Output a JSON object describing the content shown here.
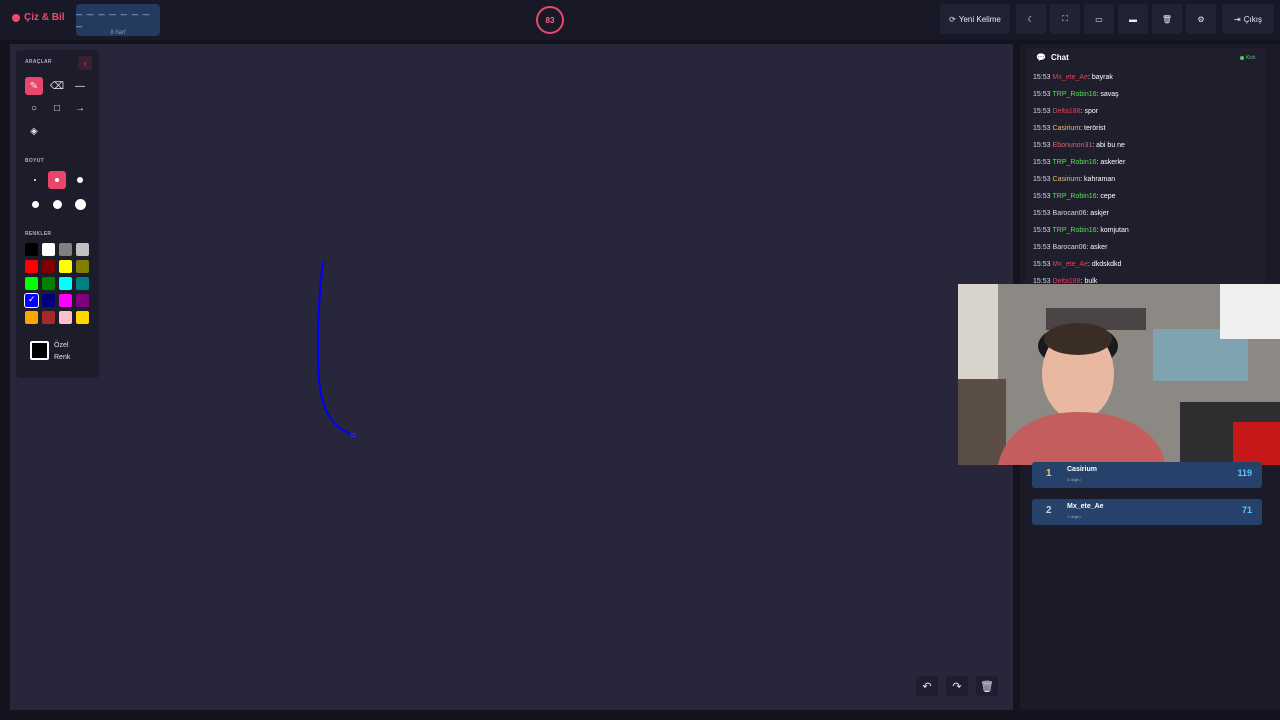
{
  "header": {
    "logo_text": "Çiz & Bil",
    "word_hint": "_ _ _ _ _ _ _ _",
    "word_length": "8 harf",
    "timer": "83",
    "new_word_label": "Yeni Kelime",
    "exit_label": "Çıkış"
  },
  "tools": {
    "section_title": "ARAÇLAR",
    "size_title": "BOYUT",
    "colors_title": "RENKLER",
    "custom_color_label_1": "Özel",
    "custom_color_label_2": "Renk",
    "active_tool": "pencil",
    "selected_size_index": 1,
    "selected_color": "#0000ff",
    "palette": [
      "#000000",
      "#ffffff",
      "#808080",
      "#c0c0c0",
      "#ff0000",
      "#800000",
      "#ffff00",
      "#808000",
      "#00ff00",
      "#008000",
      "#00ffff",
      "#008080",
      "#0000ff",
      "#000080",
      "#ff00ff",
      "#800080",
      "#ffa500",
      "#a52a2a",
      "#ffc0cb",
      "#ffd700"
    ]
  },
  "chat": {
    "title": "Chat",
    "badge": "Kick",
    "messages": [
      {
        "time": "15:53",
        "user": "Mx_ete_Ae",
        "user_color": "#e0405a",
        "text": ": bayrak"
      },
      {
        "time": "15:53",
        "user": "TRP_Robin16",
        "user_color": "#5ae05a",
        "text": ": savaş"
      },
      {
        "time": "15:53",
        "user": "Delta188",
        "user_color": "#e0405a",
        "text": ": spor"
      },
      {
        "time": "15:53",
        "user": "Casirium",
        "user_color": "#e8c060",
        "text": ": terörist"
      },
      {
        "time": "15:53",
        "user": "Ebonunon31",
        "user_color": "#e06070",
        "text": ": abi bu ne"
      },
      {
        "time": "15:53",
        "user": "TRP_Robin16",
        "user_color": "#5ae05a",
        "text": ": askerler"
      },
      {
        "time": "15:53",
        "user": "Casirium",
        "user_color": "#e8c060",
        "text": ": kahraman"
      },
      {
        "time": "15:53",
        "user": "TRP_Robin16",
        "user_color": "#5ae05a",
        "text": ": cepe"
      },
      {
        "time": "15:53",
        "user": "Barocan06",
        "user_color": "#d8d8e2",
        "text": ": askjer"
      },
      {
        "time": "15:53",
        "user": "TRP_Robin16",
        "user_color": "#5ae05a",
        "text": ": komjutan"
      },
      {
        "time": "15:53",
        "user": "Barocan06",
        "user_color": "#d8d8e2",
        "text": ": asker"
      },
      {
        "time": "15:53",
        "user": "Mx_ete_Ae",
        "user_color": "#e0405a",
        "text": ": dkdskdkd"
      },
      {
        "time": "15:53",
        "user": "Delta188",
        "user_color": "#e0405a",
        "text": ": bulk"
      }
    ]
  },
  "leaderboard": [
    {
      "rank": "1",
      "rank_color": "#f5d142",
      "name": "Casirium",
      "sub": "3 doğru",
      "score": "119"
    },
    {
      "rank": "2",
      "rank_color": "#c8d0e0",
      "name": "Mx_ete_Ae",
      "sub": "1 doğru",
      "score": "71"
    }
  ],
  "canvas": {
    "stroke_color": "#0000ff"
  }
}
